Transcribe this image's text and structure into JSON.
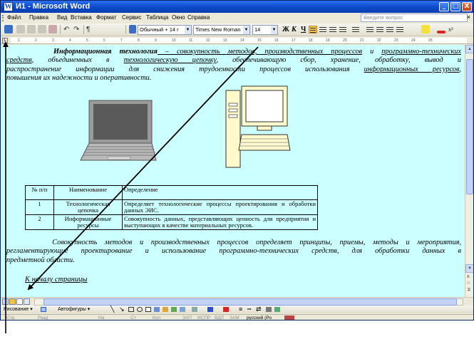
{
  "window": {
    "title": "И1 - Microsoft Word",
    "controls": {
      "minimize": "_",
      "maximize": "□",
      "close": "X"
    }
  },
  "menu": {
    "items": [
      "Файл",
      "Правка",
      "Вид",
      "Вставка",
      "Формат",
      "Сервис",
      "Таблица",
      "Окно",
      "Справка"
    ],
    "help_placeholder": "Введите вопрос",
    "close_doc": "×"
  },
  "toolbar": {
    "style": "Обычный + 14 г",
    "font": "Times New Roman",
    "size": "14",
    "bold": "Ж",
    "italic": "К",
    "underline": "Ч"
  },
  "ruler": {
    "ticks": [
      "1",
      "2",
      "3",
      "4",
      "5",
      "6",
      "7",
      "8",
      "9",
      "10",
      "11",
      "12",
      "13",
      "14",
      "15",
      "16",
      "17",
      "18",
      "19",
      "20",
      "21",
      "22",
      "23",
      "24",
      "25"
    ]
  },
  "document": {
    "para1": {
      "term": "Информационная технология",
      "l1a": " – совокупность методов, производственных процессов",
      "l1b": " и ",
      "l1c": "программно-технических",
      "l2a": "средств",
      "l2b": ", объединенных в ",
      "l2c": "технологическую цепочку",
      "l2d": ", обеспечивающую сбор, хранение, обработку, вывод и",
      "l3a": "распространение информации для снижения трудоемкости процессов использования ",
      "l3b": "информационных ресурсов",
      "l3c": ",",
      "l4": "повышения их надежности и оперативности."
    },
    "table": {
      "headers": [
        "№ п/п",
        "Наименование",
        "Определение"
      ],
      "rows": [
        {
          "num": "1",
          "name": "Технологическая цепочка",
          "definition": "Определяет технологические процессы проектирования и обработки данных ЭИС."
        },
        {
          "num": "2",
          "name": "Информационные ресурсы",
          "definition": "Совокупность данных, представляющих ценность для предприятия и выступающих в качестве материальных ресурсов."
        }
      ]
    },
    "para2": {
      "l1": "Совокупность методов и производственных процессов определяет принципы, приемы, методы и мероприятия,",
      "l2": "регламентирующие проектирование и использование программно-технических средств, для обработки данных в",
      "l3": "предметной области."
    },
    "back_link": "К началу страницы"
  },
  "drawbar": {
    "drawing": "Рисование ▾",
    "autoshapes": "Автофигуры ▾"
  },
  "statusbar": {
    "page": "Стр.",
    "section": "Разд",
    "at": "На",
    "line": "Ст",
    "col": "Кол",
    "rec": "ЗАП",
    "trk": "ИСПР",
    "ext": "ВДЛ",
    "ovr": "ЗАМ",
    "language": "русский (Ро"
  },
  "colors": {
    "page_background": "#ccffff",
    "title_bar": "#0b49c8",
    "annotation_arrow": "#000000"
  }
}
